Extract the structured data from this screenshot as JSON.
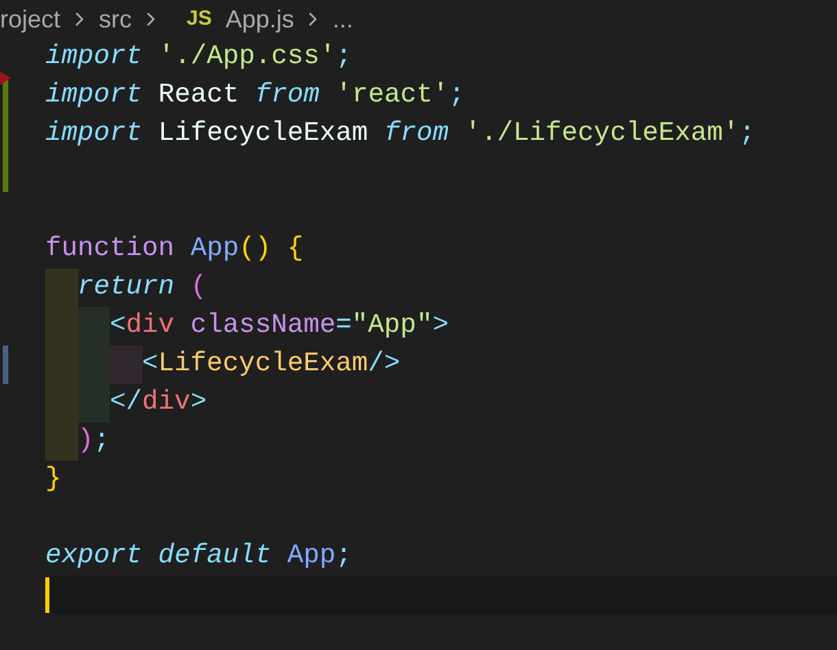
{
  "breadcrumb": {
    "items": [
      {
        "label": "roject"
      },
      {
        "label": "src"
      },
      {
        "label": "App.js",
        "badge": "JS"
      },
      {
        "label": "..."
      }
    ]
  },
  "blocks": [
    {
      "lines": [
        {
          "tokens": [
            {
              "text": "import",
              "kind": "keyword"
            },
            {
              "text": " './App.css'",
              "kind": "string"
            },
            {
              "text": ";",
              "kind": "punct"
            }
          ]
        },
        {
          "kind": "added",
          "deleted_above": true,
          "tokens": [
            {
              "text": "import",
              "kind": "keyword"
            },
            {
              "text": " React ",
              "kind": "plain"
            },
            {
              "text": "from",
              "kind": "keyword"
            },
            {
              "text": " 'react'",
              "kind": "string"
            },
            {
              "text": ";",
              "kind": "punct"
            }
          ]
        },
        {
          "kind": "added",
          "tokens": [
            {
              "text": "import",
              "kind": "keyword"
            },
            {
              "text": " LifecycleExam ",
              "kind": "plain"
            },
            {
              "text": "from",
              "kind": "keyword"
            },
            {
              "text": " './LifecycleExam'",
              "kind": "string"
            },
            {
              "text": ";",
              "kind": "punct"
            }
          ]
        },
        {
          "kind": "added"
        }
      ]
    },
    {
      "lines": [
        {
          "tokens": [
            {
              "text": "function",
              "kind": "storage"
            },
            {
              "text": " App",
              "kind": "function"
            },
            {
              "text": "()",
              "kind": "brace1"
            },
            {
              "text": " {",
              "kind": "brace1"
            }
          ],
          "children": [
            {
              "tokens": [
                {
                  "text": "return",
                  "kind": "keyword"
                },
                {
                  "text": " (",
                  "kind": "brace2"
                }
              ],
              "children": [
                {
                  "tokens": [
                    {
                      "text": "<",
                      "kind": "punct"
                    },
                    {
                      "text": "div",
                      "kind": "tag"
                    },
                    {
                      "text": " className",
                      "kind": "attr"
                    },
                    {
                      "text": "=",
                      "kind": "punct"
                    },
                    {
                      "text": "\"App\"",
                      "kind": "string"
                    },
                    {
                      "text": ">",
                      "kind": "punct"
                    }
                  ],
                  "children": [
                    {
                      "kind": "modified",
                      "tokens": [
                        {
                          "text": "<",
                          "kind": "punct"
                        },
                        {
                          "text": "LifecycleExam",
                          "kind": "component"
                        },
                        {
                          "text": "/>",
                          "kind": "punct"
                        }
                      ]
                    }
                  ]
                },
                {
                  "tokens": [
                    {
                      "text": "</",
                      "kind": "punct"
                    },
                    {
                      "text": "div",
                      "kind": "tag"
                    },
                    {
                      "text": ">",
                      "kind": "punct"
                    }
                  ]
                }
              ]
            },
            {
              "tokens": [
                {
                  "text": ")",
                  "kind": "brace2"
                },
                {
                  "text": ";",
                  "kind": "punct"
                }
              ]
            }
          ]
        },
        {
          "tokens": [
            {
              "text": "}",
              "kind": "brace1"
            }
          ]
        }
      ]
    },
    {
      "lines": [
        {
          "tokens": [
            {
              "text": "export default",
              "kind": "keyword"
            },
            {
              "text": " App",
              "kind": "function"
            },
            {
              "text": ";",
              "kind": "punct"
            }
          ]
        },
        {
          "current": true
        }
      ]
    }
  ]
}
